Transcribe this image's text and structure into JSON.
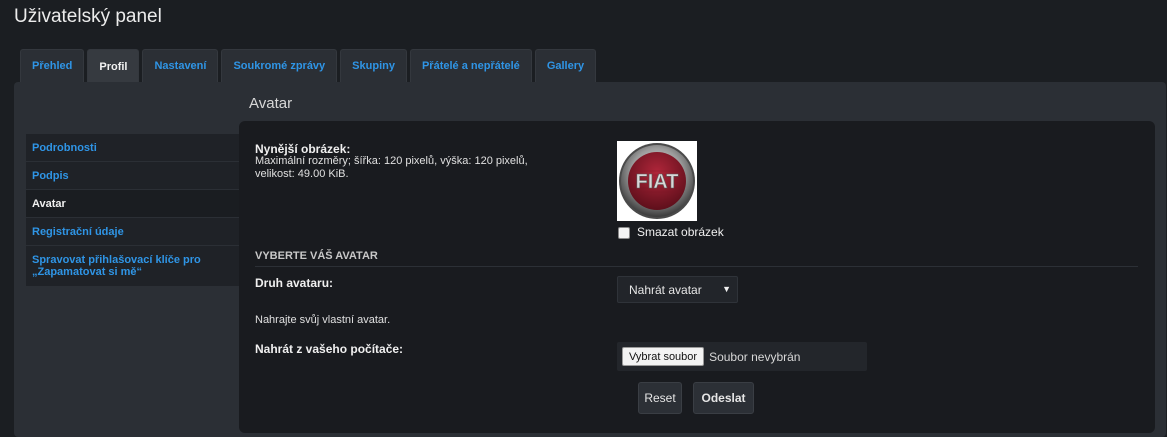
{
  "page": {
    "title": "Uživatelský panel"
  },
  "tabs": [
    {
      "label": "Přehled",
      "active": false
    },
    {
      "label": "Profil",
      "active": true
    },
    {
      "label": "Nastavení",
      "active": false
    },
    {
      "label": "Soukromé zprávy",
      "active": false
    },
    {
      "label": "Skupiny",
      "active": false
    },
    {
      "label": "Přátelé a nepřátelé",
      "active": false
    },
    {
      "label": "Gallery",
      "active": false
    }
  ],
  "sidebar": {
    "items": [
      {
        "label": "Podrobnosti",
        "active": false
      },
      {
        "label": "Podpis",
        "active": false
      },
      {
        "label": "Avatar",
        "active": true
      },
      {
        "label": "Registrační údaje",
        "active": false
      },
      {
        "label": "Spravovat přihlašovací klíče pro „Zapamatovat si mě“",
        "active": false
      }
    ]
  },
  "section": {
    "title": "Avatar"
  },
  "current": {
    "label": "Nynější obrázek:",
    "desc_line1": "Maximální rozměry; šířka: 120 pixelů, výška: 120 pixelů,",
    "desc_line2": "velikost: 49.00 KiB.",
    "image_text": "FIAT",
    "delete_label": "Smazat obrázek",
    "delete_checked": false
  },
  "choose": {
    "heading": "VYBERTE VÁŠ AVATAR"
  },
  "avatar_type": {
    "label": "Druh avataru:",
    "selected": "Nahrát avatar"
  },
  "upload": {
    "hint": "Nahrajte svůj vlastní avatar.",
    "label": "Nahrát z vašeho počítače:",
    "button": "Vybrat soubor",
    "status": "Soubor nevybrán"
  },
  "actions": {
    "reset": "Reset",
    "submit": "Odeslat"
  },
  "colors": {
    "background": "#1b1e22",
    "panel": "#2b2f35",
    "content": "#191b1f",
    "link": "#2f95e6",
    "logo_red": "#8e1b2b"
  }
}
